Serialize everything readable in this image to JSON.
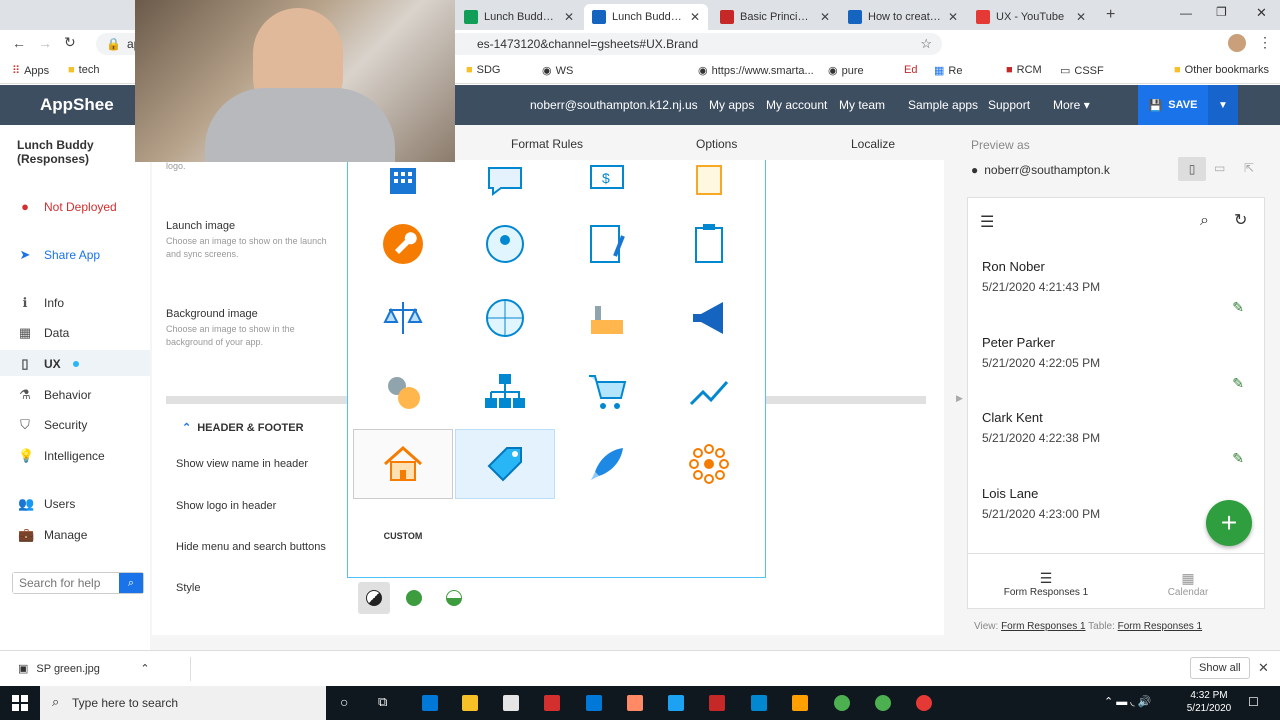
{
  "browser": {
    "tabs": [
      {
        "title": "Lunch Buddy (Re",
        "color": "#0f9d58",
        "active": false
      },
      {
        "title": "Lunch Buddy (Re",
        "color": "#1565c0",
        "active": true
      },
      {
        "title": "Basic Principles o",
        "color": "#c62828",
        "active": false
      },
      {
        "title": "How to create a",
        "color": "#1565c0",
        "active": false
      },
      {
        "title": "UX - YouTube",
        "color": "#e53935",
        "active": false
      }
    ],
    "url_prefix": "app",
    "url": "es-1473120&channel=gsheets#UX.Brand",
    "bookmarks": [
      "Apps",
      "tech",
      "SDG",
      "WS",
      "https://www.smarta...",
      "pure",
      "Ed",
      "Re",
      "RCM",
      "CSSF",
      "Other bookmarks"
    ]
  },
  "appsheet": {
    "logo": "AppShee",
    "user_email": "noberr@southampton.k12.nj.us",
    "nav": [
      "My apps",
      "My account",
      "My team",
      "Sample apps",
      "Support",
      "More"
    ],
    "save_label": "SAVE"
  },
  "sidebar": {
    "app_title": "Lunch Buddy (Responses)",
    "deploy_status": "Not Deployed",
    "share_label": "Share App",
    "items": [
      "Info",
      "Data",
      "UX",
      "Behavior",
      "Security",
      "Intelligence",
      "Users",
      "Manage"
    ],
    "search_placeholder": "Search for help"
  },
  "main": {
    "subtabs": [
      "Format Rules",
      "Options",
      "Localize"
    ],
    "fields": {
      "logo_hint": "logo.",
      "launch_label": "Launch image",
      "launch_hint": "Choose an image to show on the launch and sync screens.",
      "bg_label": "Background image",
      "bg_hint": "Choose an image to show in the background of your app.",
      "section_title": "HEADER & FOOTER",
      "show_view_name": "Show view name in header",
      "show_logo": "Show logo in header",
      "hide_menu": "Hide menu and search buttons",
      "style": "Style"
    },
    "custom_label": "CUSTOM",
    "style_colors": [
      "#222222",
      "#3d9c3d",
      "#3d9c3d"
    ]
  },
  "preview": {
    "label": "Preview as",
    "email": "noberr@southampton.k",
    "rows": [
      {
        "name": "Ron Nober",
        "date": "5/21/2020 4:21:43 PM"
      },
      {
        "name": "Peter Parker",
        "date": "5/21/2020 4:22:05 PM"
      },
      {
        "name": "Clark Kent",
        "date": "5/21/2020 4:22:38 PM"
      },
      {
        "name": "Lois Lane",
        "date": "5/21/2020 4:23:00 PM"
      }
    ],
    "footer_tabs": [
      "Form Responses 1",
      "Calendar"
    ],
    "view_label": "View:",
    "view_value": "Form Responses 1",
    "table_label": "Table:",
    "table_value": "Form Responses 1"
  },
  "download": {
    "file": "SP green.jpg",
    "show_all": "Show all"
  },
  "taskbar": {
    "search": "Type here to search",
    "time": "4:32 PM",
    "date": "5/21/2020"
  }
}
